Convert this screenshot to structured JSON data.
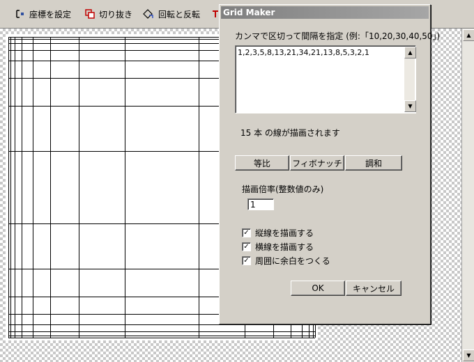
{
  "toolbar": {
    "items": [
      {
        "label": "座標を設定",
        "icon": "coordinate-icon"
      },
      {
        "label": "切り抜き",
        "icon": "crop-icon"
      },
      {
        "label": "回転と反転",
        "icon": "rotate-flip-icon"
      },
      {
        "label": "",
        "icon": "partial-icon"
      }
    ]
  },
  "dialog": {
    "title": "Grid Maker",
    "instruction": "カンマで区切って間隔を指定 (例:「10,20,30,40,50」)",
    "intervals_value": "1,2,3,5,8,13,21,34,21,13,8,5,3,2,1",
    "line_count_text": "15 本 の線が描画されます",
    "preset_buttons": [
      "等比",
      "フィボナッチ",
      "調和"
    ],
    "scale_label": "描画倍率(整数値のみ)",
    "scale_value": "1",
    "checkboxes": [
      {
        "label": "縦線を描画する",
        "checked": true
      },
      {
        "label": "横線を描画する",
        "checked": true
      },
      {
        "label": "周囲に余白をつくる",
        "checked": true
      }
    ],
    "ok_label": "OK",
    "cancel_label": "キャンセル"
  },
  "grid": {
    "intervals": [
      1,
      2,
      3,
      5,
      8,
      13,
      21,
      34,
      21,
      13,
      8,
      5,
      3,
      2,
      1
    ]
  },
  "colors": {
    "titlebar_start": "#7f7f7f",
    "titlebar_end": "#a6a6a6",
    "face": "#d4d0c8",
    "checker": "#c8c8c8",
    "grid_line": "#000000"
  }
}
